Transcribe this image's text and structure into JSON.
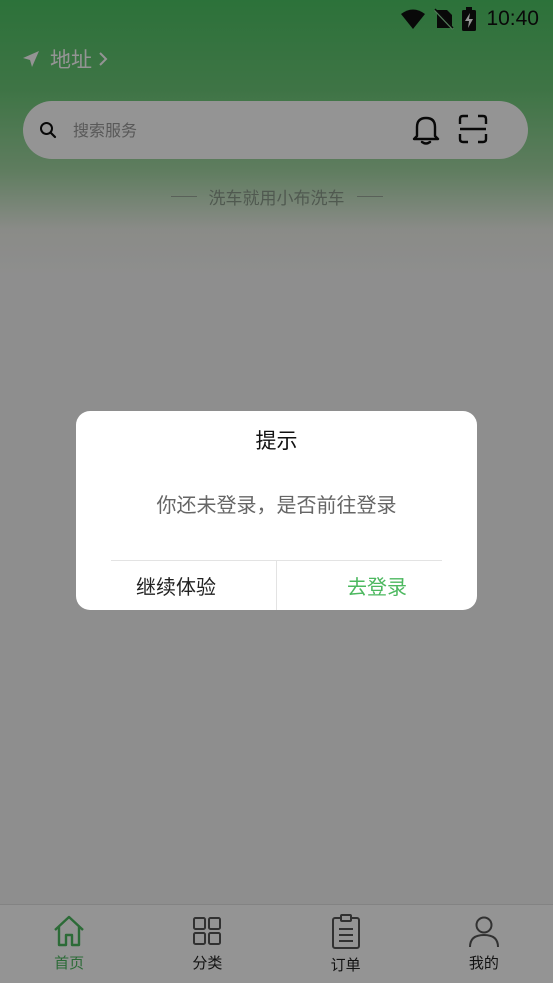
{
  "status_bar": {
    "time": "10:40",
    "icons": [
      "wifi-icon",
      "no-sim-icon",
      "battery-charging-icon"
    ]
  },
  "header": {
    "location_label": "地址",
    "location_icon": "navigation-arrow-icon"
  },
  "search": {
    "placeholder": "搜索服务",
    "value": ""
  },
  "slogan": "洗车就用小布洗车",
  "dialog": {
    "title": "提示",
    "message": "你还未登录，是否前往登录",
    "cancel_label": "继续体验",
    "confirm_label": "去登录"
  },
  "tab_bar": {
    "items": [
      {
        "label": "首页",
        "icon": "home-icon",
        "active": true
      },
      {
        "label": "分类",
        "icon": "grid-icon",
        "active": false
      },
      {
        "label": "订单",
        "icon": "clipboard-icon",
        "active": false
      },
      {
        "label": "我的",
        "icon": "person-icon",
        "active": false
      }
    ]
  },
  "colors": {
    "brand_green": "#4cb85f",
    "header_green": "#4dc464",
    "overlay": "rgba(0,0,0,0.42)"
  }
}
